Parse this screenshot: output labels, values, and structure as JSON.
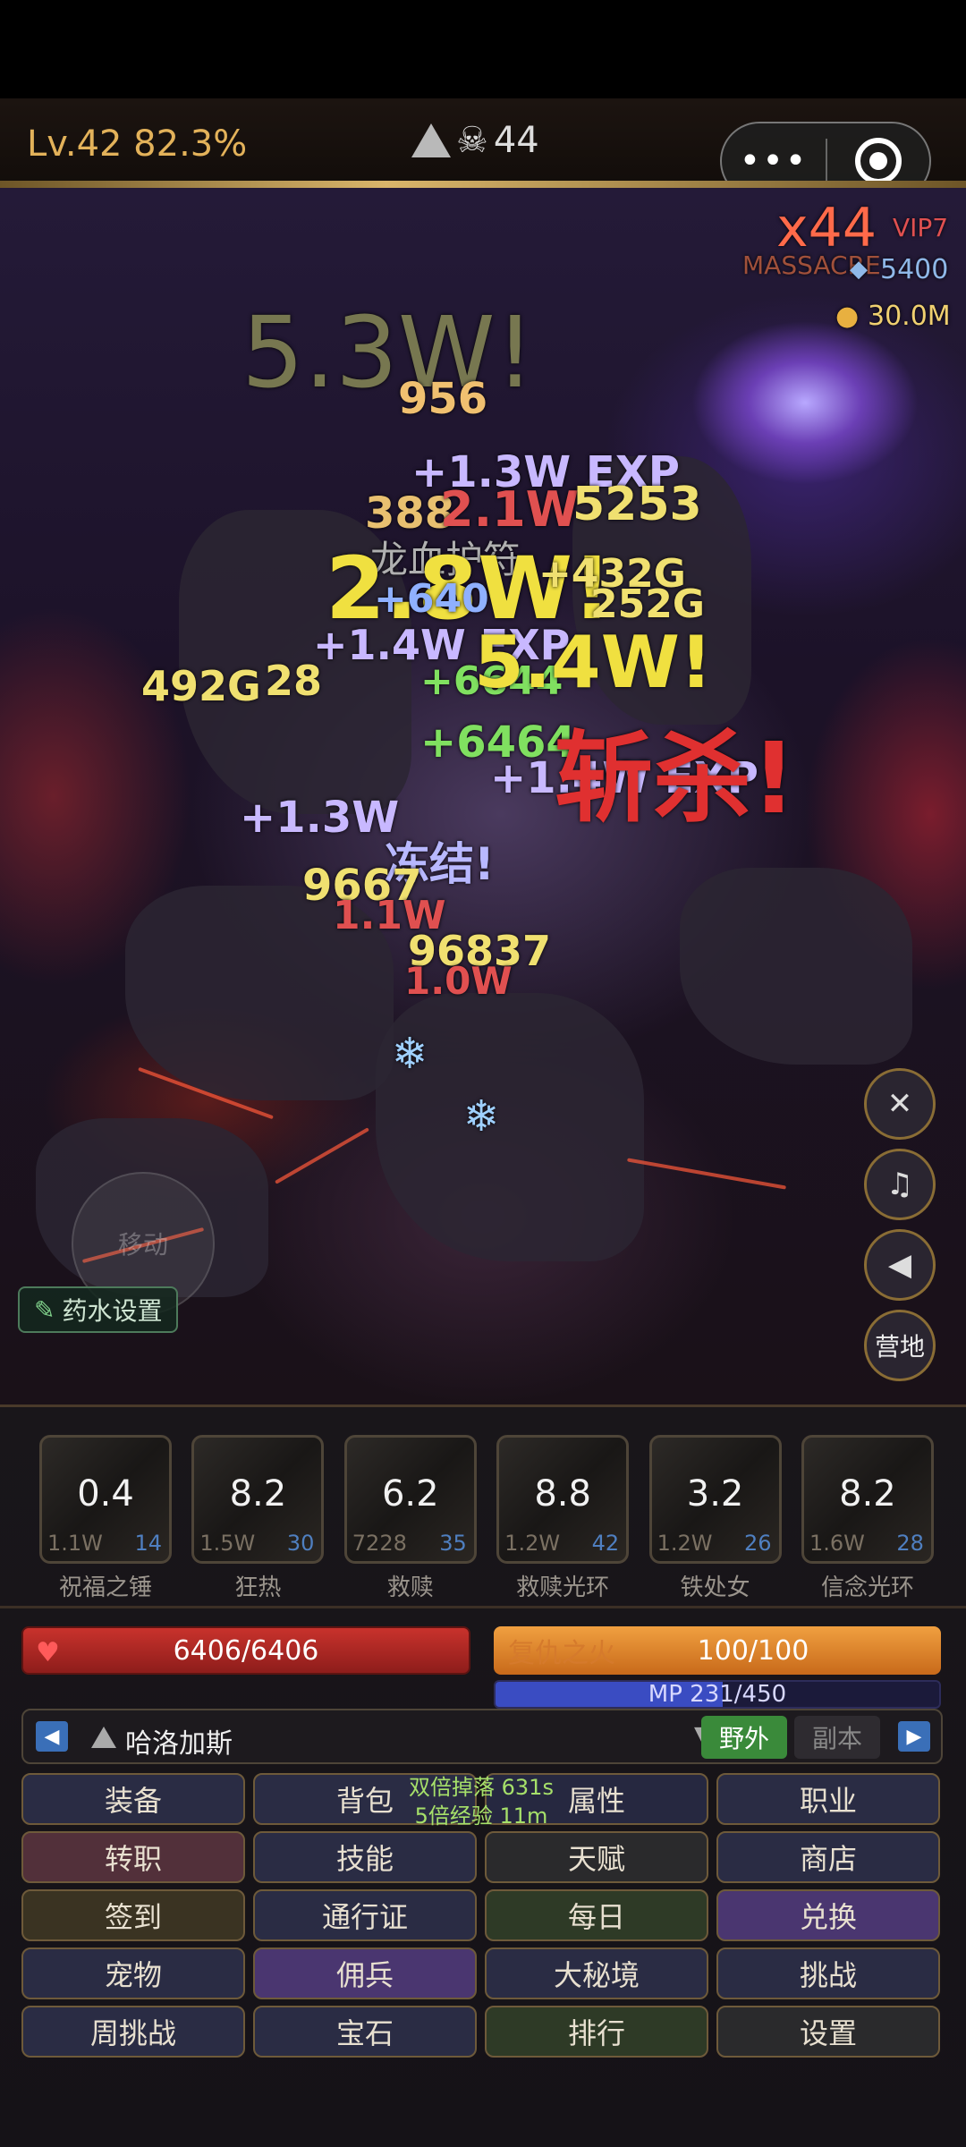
{
  "topbar": {
    "level": "Lv.42 82.3%",
    "kill_count": "44",
    "icons": [
      "triangle-map-icon",
      "skull-icon"
    ],
    "capsule": {
      "more": "•••",
      "target": "target-icon"
    }
  },
  "game": {
    "combo": "x44",
    "combo_label": "MASSACRE",
    "vip": "VIP7",
    "diamonds": "5400",
    "gold": "30.0M",
    "floating_texts": [
      {
        "t": "5.3W!",
        "c": "#777750"
      },
      {
        "t": "956",
        "c": "#f0c070"
      },
      {
        "t": "+1.3W EXP",
        "c": "#c8b8ff"
      },
      {
        "t": "388",
        "c": "#e8c070"
      },
      {
        "t": "2.1W",
        "c": "#e05050"
      },
      {
        "t": "5253",
        "c": "#f0e070"
      },
      {
        "t": "龙血护符",
        "c": "#b0b0b0"
      },
      {
        "t": "2.8W!",
        "c": "#f0e040"
      },
      {
        "t": "+432G",
        "c": "#f0e070"
      },
      {
        "t": "+640",
        "c": "#8fb0ff"
      },
      {
        "t": "252G",
        "c": "#f0e070"
      },
      {
        "t": "+1.4W EXP",
        "c": "#c8b8ff"
      },
      {
        "t": "+6644",
        "c": "#80e060"
      },
      {
        "t": "5.4W!",
        "c": "#f0e040"
      },
      {
        "t": "492G",
        "c": "#f0e070"
      },
      {
        "t": "28",
        "c": "#f0e070"
      },
      {
        "t": "+6464",
        "c": "#80e060"
      },
      {
        "t": "+1.4W EXP",
        "c": "#c8b8ff"
      },
      {
        "t": "+1.3W",
        "c": "#c8b8ff"
      },
      {
        "t": "冻结!",
        "c": "#b8b8ff"
      },
      {
        "t": "9667",
        "c": "#f0e070"
      },
      {
        "t": "1.1W",
        "c": "#e05050"
      },
      {
        "t": "96837",
        "c": "#f0e070"
      },
      {
        "t": "1.0W",
        "c": "#e05050"
      },
      {
        "t": "斩杀!",
        "c": "#e03030"
      }
    ],
    "move_label": "移动",
    "potion_label": "药水设置",
    "side_buttons": [
      "close-icon",
      "music-icon",
      "volume-icon"
    ],
    "camp_label": "营地"
  },
  "skills": [
    {
      "name": "祝福之锤",
      "cd": "0.4",
      "dmg": "1.1W",
      "level": "14"
    },
    {
      "name": "狂热",
      "cd": "8.2",
      "dmg": "1.5W",
      "level": "30"
    },
    {
      "name": "救赎",
      "cd": "6.2",
      "dmg": "7228",
      "level": "35"
    },
    {
      "name": "救赎光环",
      "cd": "8.8",
      "dmg": "1.2W",
      "level": "42"
    },
    {
      "name": "铁处女",
      "cd": "3.2",
      "dmg": "1.2W",
      "level": "26"
    },
    {
      "name": "信念光环",
      "cd": "8.2",
      "dmg": "1.6W",
      "level": "28"
    }
  ],
  "stats": {
    "hp": "6406/6406",
    "rage_label": "复仇之火",
    "rage": "100/100",
    "mp": "MP 231/450",
    "mp_fraction": 0.513
  },
  "map": {
    "name": "哈洛加斯",
    "wild": "野外",
    "dungeon": "副本"
  },
  "buffs": {
    "drop": "双倍掉落 631s",
    "exp": "5倍经验 11m"
  },
  "menu": [
    {
      "label": "装备",
      "style": "blue"
    },
    {
      "label": "背包",
      "style": "blue"
    },
    {
      "label": "属性",
      "style": "navy"
    },
    {
      "label": "职业",
      "style": "blue"
    },
    {
      "label": "转职",
      "style": "red"
    },
    {
      "label": "技能",
      "style": "blue"
    },
    {
      "label": "天赋",
      "style": "dark"
    },
    {
      "label": "商店",
      "style": "blue"
    },
    {
      "label": "签到",
      "style": "olive"
    },
    {
      "label": "通行证",
      "style": "blue"
    },
    {
      "label": "每日",
      "style": "green"
    },
    {
      "label": "兑换",
      "style": "purple"
    },
    {
      "label": "宠物",
      "style": "blue"
    },
    {
      "label": "佣兵",
      "style": "purple"
    },
    {
      "label": "大秘境",
      "style": "blue"
    },
    {
      "label": "挑战",
      "style": "blue"
    },
    {
      "label": "周挑战",
      "style": "blue"
    },
    {
      "label": "宝石",
      "style": "blue"
    },
    {
      "label": "排行",
      "style": "green"
    },
    {
      "label": "设置",
      "style": "dark"
    }
  ]
}
